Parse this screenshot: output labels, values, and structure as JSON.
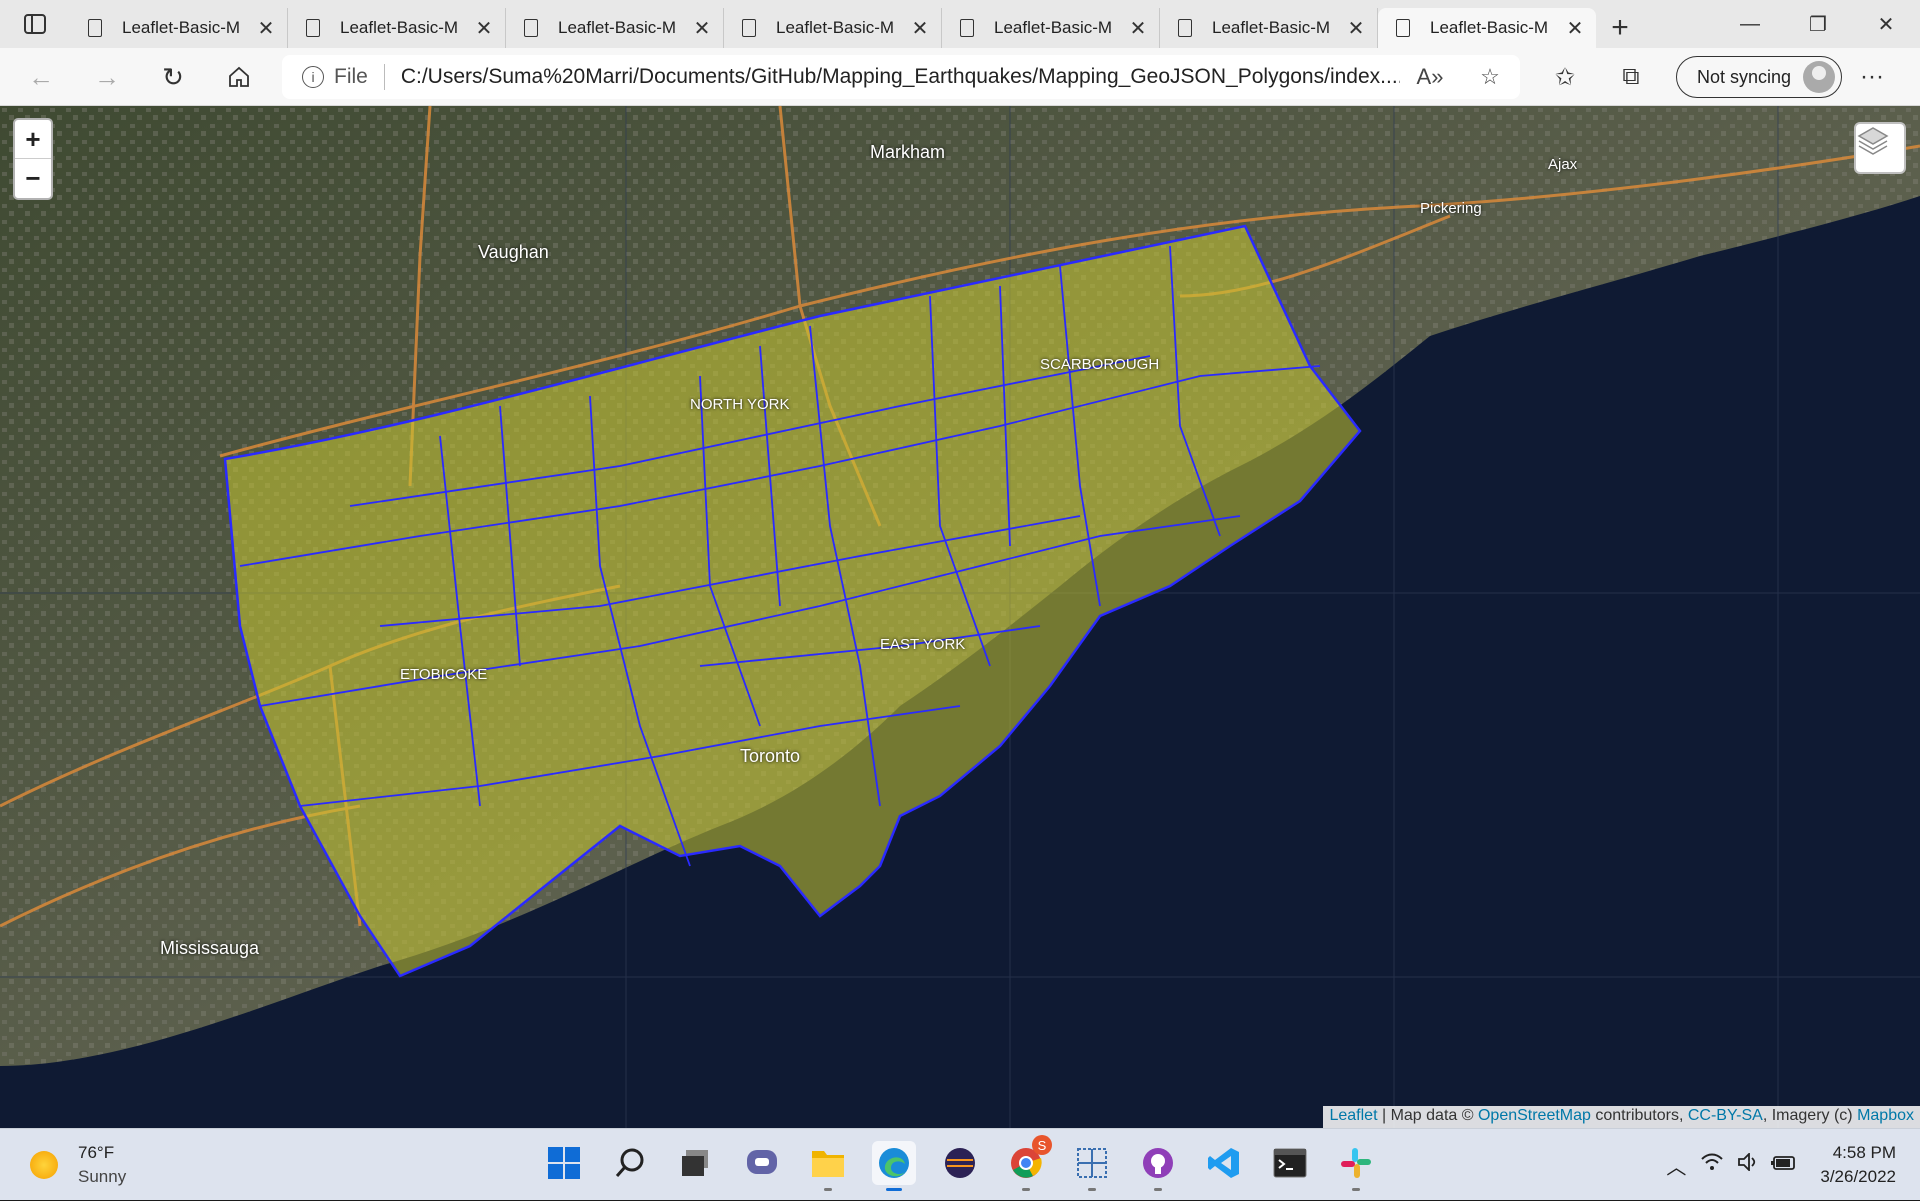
{
  "tabs": [
    {
      "title": "Leaflet-Basic-M",
      "active": false
    },
    {
      "title": "Leaflet-Basic-M",
      "active": false
    },
    {
      "title": "Leaflet-Basic-M",
      "active": false
    },
    {
      "title": "Leaflet-Basic-M",
      "active": false
    },
    {
      "title": "Leaflet-Basic-M",
      "active": false
    },
    {
      "title": "Leaflet-Basic-M",
      "active": false
    },
    {
      "title": "Leaflet-Basic-M",
      "active": true
    }
  ],
  "address": {
    "scheme_label": "File",
    "url": "C:/Users/Suma%20Marri/Documents/GitHub/Mapping_Earthquakes/Mapping_GeoJSON_Polygons/index...."
  },
  "profile": {
    "sync_label": "Not syncing"
  },
  "map": {
    "zoom_in": "+",
    "zoom_out": "−",
    "polygon_color": "#2a2aff",
    "polygon_fill": "#c8c832",
    "labels": {
      "markham": "Markham",
      "vaughan": "Vaughan",
      "toronto": "Toronto",
      "mississauga": "Mississauga",
      "pickering": "Pickering",
      "ajax": "Ajax",
      "north_york": "NORTH YORK",
      "scarborough": "SCARBOROUGH",
      "etobicoke": "ETOBICOKE",
      "east_york": "EAST YORK"
    },
    "attribution": {
      "leaflet": "Leaflet",
      "sep1": " | Map data © ",
      "osm": "OpenStreetMap",
      "contrib": " contributors, ",
      "license": "CC-BY-SA",
      "imagery": ", Imagery (c) ",
      "mapbox": "Mapbox"
    }
  },
  "taskbar": {
    "weather_temp": "76°F",
    "weather_desc": "Sunny",
    "time": "4:58 PM",
    "date": "3/26/2022",
    "apps": [
      "start-icon",
      "search-icon",
      "task-view-icon",
      "teams-chat-icon",
      "file-explorer-icon",
      "edge-icon",
      "eclipse-icon",
      "chrome-icon",
      "snipping-tool-icon",
      "github-desktop-icon",
      "vscode-icon",
      "terminal-icon",
      "slack-icon"
    ],
    "chrome_badge": "S"
  }
}
